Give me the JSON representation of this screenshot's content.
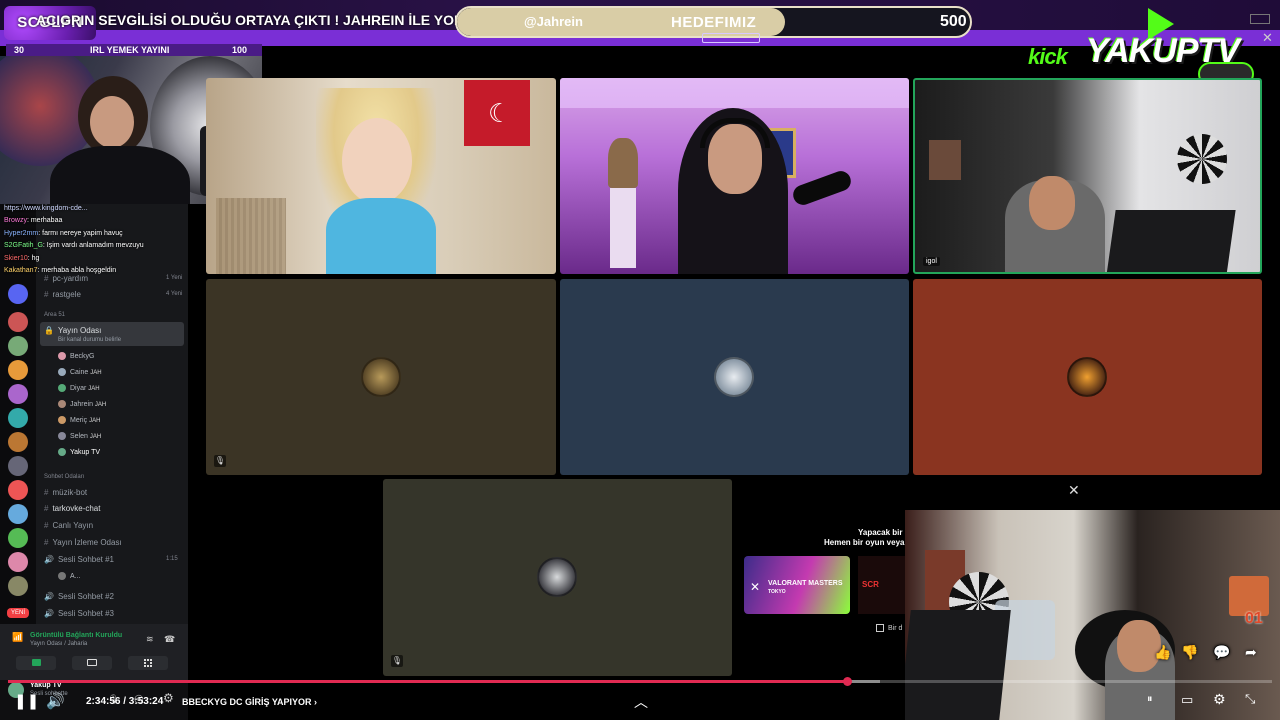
{
  "banner": {
    "logo_text": "SCGLPN",
    "ticker": "ACIGPIN SEVGİLİSİ OLDUĞU ORTAYA ÇIKTI ! JAHREIN İLE YOLLAR AYRILDI w/",
    "handle": "@Jahrein",
    "goal_label": "HEDEFIMIZ",
    "goal_value": "500",
    "goal_progress": 0.64
  },
  "sub_counter": {
    "left": "30",
    "title": "IRL YEMEK YAYINI",
    "right": "100"
  },
  "brand": {
    "kick": "kick",
    "name": "YAKUPTV"
  },
  "chat": [
    {
      "user": "",
      "text": "https://www.kingdom-cde...",
      "color": "#cfd8ff"
    },
    {
      "user": "Browzy",
      "text": ": merhabaa",
      "color": "#ff7ad9"
    },
    {
      "user": "Hyper2mm",
      "text": ": farmı nereye yapim havuç",
      "color": "#8ab4ff"
    },
    {
      "user": "S2GFatih_G",
      "text": ": Işim vardı anlamadım mevzuyu",
      "color": "#7dff8a"
    },
    {
      "user": "Skier10",
      "text": ": hg",
      "color": "#ff6a6a"
    },
    {
      "user": "Kakathan7",
      "text": ": merhaba abla hoşgeldin",
      "color": "#ffd36a"
    }
  ],
  "sidebar": {
    "channels_top": [
      {
        "label": "pc-yardım",
        "meta": "1 Yeni"
      },
      {
        "label": "rastgele",
        "meta": "4 Yeni"
      }
    ],
    "category_area": "Area 51",
    "voice_channel": {
      "label": "Yayın Odası",
      "sub": "Bir kanal durumu belirle"
    },
    "members": [
      {
        "name": "BeckyG",
        "tag": ""
      },
      {
        "name": "Caine",
        "tag": "JAH"
      },
      {
        "name": "Diyar",
        "tag": "JAH"
      },
      {
        "name": "Jahrein",
        "tag": "JAH"
      },
      {
        "name": "Meriç",
        "tag": "JAH"
      },
      {
        "name": "Selen",
        "tag": "JAH"
      },
      {
        "name": "Yakup TV",
        "tag": ""
      }
    ],
    "category_chat": "Sohbet Odaları",
    "channels_bottom": [
      {
        "label": "müzik-bot",
        "meta": "",
        "bright": false
      },
      {
        "label": "tarkovke-chat",
        "meta": "",
        "bright": true
      },
      {
        "label": "Canlı Yayın",
        "meta": "",
        "bright": false
      },
      {
        "label": "Yayın İzleme Odası",
        "meta": "",
        "bright": false
      },
      {
        "label": "Sesli Sohbet #1",
        "meta": "1:15",
        "bright": false
      },
      {
        "label": "Sesli Sohbet #2",
        "meta": "",
        "bright": false
      },
      {
        "label": "Sesli Sohbet #3",
        "meta": "",
        "bright": false
      }
    ],
    "sub_member": "A...",
    "voice_connected": "Görüntülü Bağlantı Kuruldu",
    "voice_sub": "Yayın Odası / Jaharia",
    "new_badge": "YENİ",
    "user_name": "Yakup TV",
    "user_status": "Sesli sohbette"
  },
  "activity": {
    "title": "Yapacak bir ş",
    "subtitle": "Hemen bir oyun veya vi",
    "card_title": "VALORANT MASTERS",
    "card_sub": "TOKYO",
    "second_card": "SCR",
    "checkbox": "Bir d"
  },
  "player": {
    "time": "2:34:56 / 3:53:24",
    "chapter": "BBECKYG DC GİRİŞ YAPIYOR",
    "progress": 0.664,
    "buffered": 0.69
  },
  "tags": {
    "igol": "igol",
    "pip_badge": "01"
  }
}
